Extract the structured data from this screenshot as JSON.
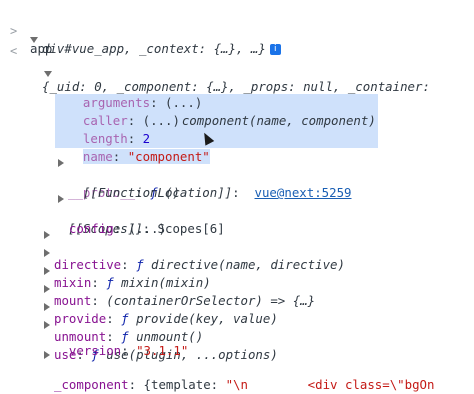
{
  "console": {
    "prompt_symbol": ">",
    "input": "app",
    "result_symbol": "<",
    "summary_line1": "{_uid: 0, _component: {…}, _props: null, _container:",
    "summary_line2": "div#vue_app, _context: {…}, …}",
    "info_badge": "i",
    "component": {
      "key": "component",
      "sep": ":",
      "f": "ƒ",
      "sig": " component(name, component)",
      "arguments_key": "arguments",
      "arguments_val": "(...)",
      "caller_key": "caller",
      "caller_val": "(...)",
      "length_key": "length",
      "length_val": "2",
      "name_key": "name",
      "name_val": "\"component\"",
      "proto_key": "__proto__",
      "proto_val": " ()",
      "fnloc_key": "[[FunctionLocation]]",
      "fnloc_val": "vue@next:5259",
      "scopes_key": "[[Scopes]]",
      "scopes_val": "Scopes[6]"
    },
    "rows": {
      "config_key": "config",
      "config_val": "(...)",
      "directive_key": "directive",
      "directive_sig": " directive(name, directive)",
      "mixin_key": "mixin",
      "mixin_sig": " mixin(mixin)",
      "mount_key": "mount",
      "mount_sig": "(containerOrSelector) => {…}",
      "provide_key": "provide",
      "provide_sig": " provide(key, value)",
      "unmount_key": "unmount",
      "unmount_sig": " unmount()",
      "use_key": "use",
      "use_sig": " use(plugin, ...options)",
      "version_key": "version",
      "version_val": "\"3.1.1\"",
      "comp_key": "_component",
      "comp_val_prefix": "{template: ",
      "comp_val_str": "\"\\n        <div class=\\\"bgOn"
    }
  }
}
